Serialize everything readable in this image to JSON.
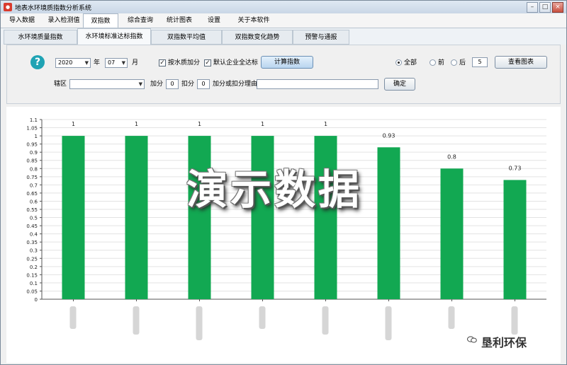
{
  "window": {
    "title": "地表水环境质指数分析系统"
  },
  "menu": [
    {
      "label": "导入数据",
      "active": false
    },
    {
      "label": "录入检测值",
      "active": false
    },
    {
      "label": "双指数",
      "active": true
    },
    {
      "label": "综合查询",
      "active": false
    },
    {
      "label": "统计图表",
      "active": false
    },
    {
      "label": "设置",
      "active": false
    },
    {
      "label": "关于本软件",
      "active": false
    }
  ],
  "subtabs": [
    {
      "label": "水环境质量指数",
      "active": false
    },
    {
      "label": "水环境标准达标指数",
      "active": true
    },
    {
      "label": "双指数平均值",
      "active": false
    },
    {
      "label": "双指数变化趋势",
      "active": false
    },
    {
      "label": "预警与通报",
      "active": false
    }
  ],
  "controls": {
    "year_value": "2020",
    "year_label": "年",
    "month_value": "07",
    "month_label": "月",
    "add_by_water_quality_label": "按水质加分",
    "add_by_water_quality_checked": true,
    "default_all_compliant_label": "默认企业全达标",
    "default_all_compliant_checked": true,
    "calculate_button": "计算指数",
    "radio_all_label": "全部",
    "radio_front_label": "前",
    "radio_back_label": "后",
    "radio_selected": "全部",
    "top_n_value": "5",
    "view_chart_button": "查看图表",
    "district_label": "辖区",
    "district_value": "",
    "bonus_label": "加分",
    "bonus_value": "0",
    "deduct_label": "扣分",
    "deduct_value": "0",
    "reason_label": "加分或扣分理由",
    "reason_value": "",
    "confirm_button": "确定"
  },
  "chart_data": {
    "type": "bar",
    "categories": [
      "",
      "",
      "",
      "",
      "",
      "",
      "",
      ""
    ],
    "values": [
      1,
      1,
      1,
      1,
      1,
      0.93,
      0.8,
      0.73
    ],
    "data_labels": [
      "1",
      "1",
      "1",
      "1",
      "1",
      "0.93",
      "0.8",
      "0.73"
    ],
    "ylim": [
      0,
      1.1
    ],
    "yticks": [
      "0",
      "0.05",
      "0.1",
      "0.15",
      "0.2",
      "0.25",
      "0.3",
      "0.35",
      "0.4",
      "0.45",
      "0.5",
      "0.55",
      "0.6",
      "0.65",
      "0.7",
      "0.75",
      "0.8",
      "0.85",
      "0.9",
      "0.95",
      "1",
      "1.05",
      "1.1"
    ],
    "bar_color": "#12a852",
    "grid": true
  },
  "overlay": {
    "watermark": "演示数据",
    "brand": "垦利环保"
  }
}
